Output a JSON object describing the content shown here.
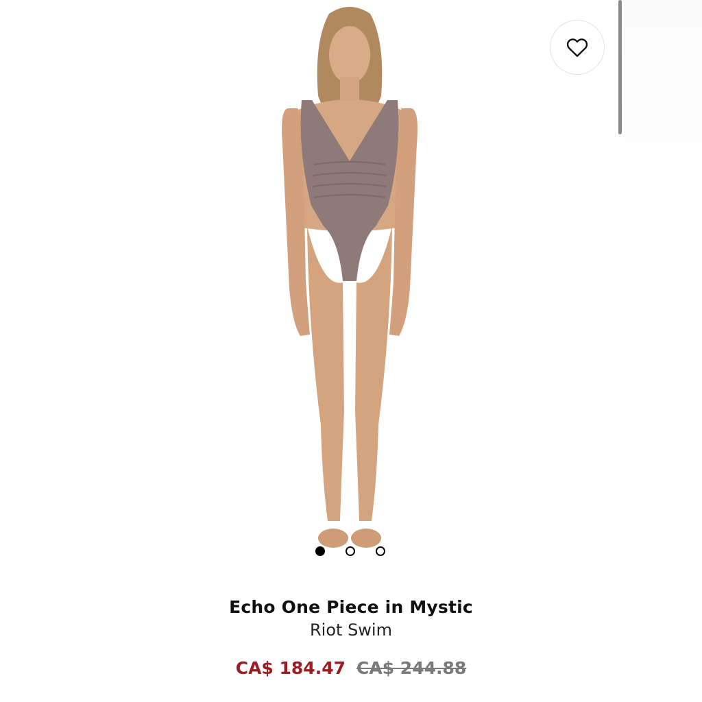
{
  "gallery": {
    "image_alt": "Model wearing mauve one-piece swimsuit",
    "swimsuit_color": "#8e7a78",
    "skin_color": "#d6a783",
    "hair_color": "#b08a5e",
    "active_slide": 1,
    "slide_count": 3
  },
  "wishlist": {
    "icon": "heart-outline-icon"
  },
  "product": {
    "name": "Echo One Piece in Mystic",
    "brand": "Riot Swim",
    "sale_price": "CA$ 184.47",
    "original_price": "CA$ 244.88"
  },
  "colors": {
    "sale_price": "#9b1c22",
    "original_price": "#7a7a7a",
    "text_primary": "#111111"
  }
}
